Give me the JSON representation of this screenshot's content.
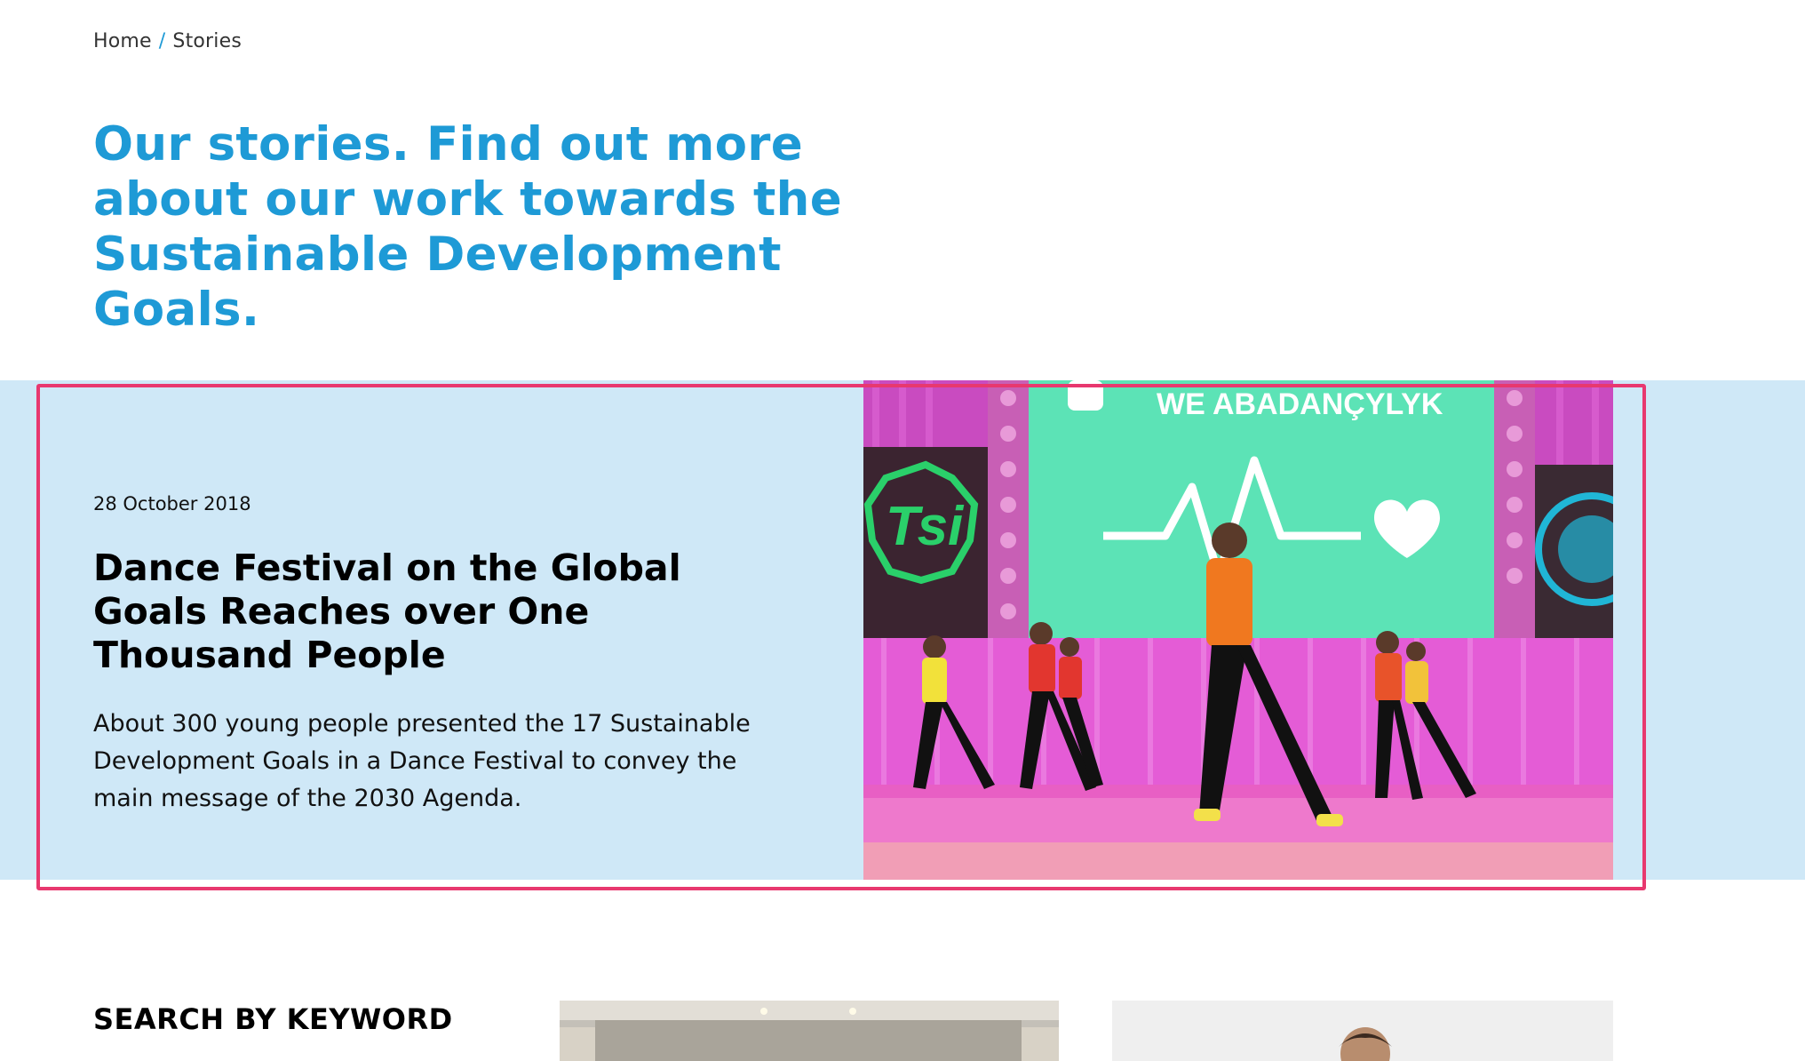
{
  "breadcrumb": {
    "home": "Home",
    "separator": "/",
    "current": "Stories"
  },
  "page": {
    "title": "Our stories. Find out more about our work towards the Sustainable Development Goals."
  },
  "featured_story": {
    "date": "28 October 2018",
    "title": "Dance Festival on the Global Goals Reaches over One Thousand People",
    "summary": "About 300 young people presented the 17 Sustainable Development Goals in a Dance Festival to convey the main message of the 2030 Agenda.",
    "image_screen_text": "WE ABADANÇYLYK"
  },
  "search": {
    "heading": "SEARCH BY KEYWORD"
  },
  "colors": {
    "accent_blue": "#1e9ad6",
    "feature_band": "#cfe8f7",
    "highlight_border": "#e8386f"
  }
}
